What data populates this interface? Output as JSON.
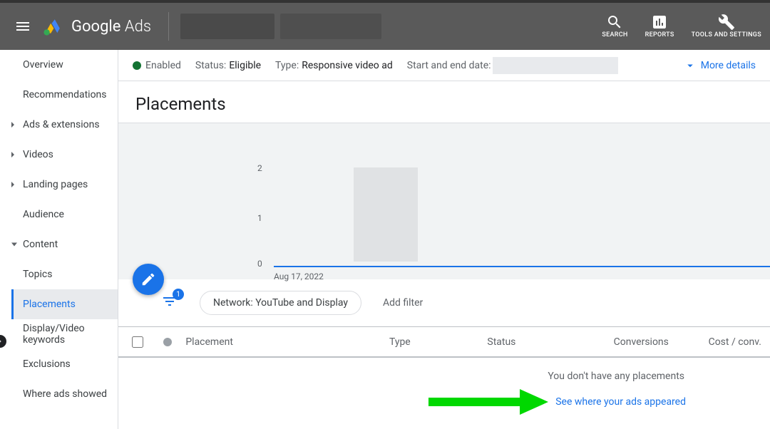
{
  "header": {
    "logo_text1": "Google",
    "logo_text2": "Ads",
    "actions": {
      "search": "SEARCH",
      "reports": "REPORTS",
      "tools": "TOOLS AND SETTINGS"
    }
  },
  "sidebar": {
    "items": [
      {
        "label": "Overview",
        "arrow": false
      },
      {
        "label": "Recommendations",
        "arrow": false
      },
      {
        "label": "Ads & extensions",
        "arrow": true
      },
      {
        "label": "Videos",
        "arrow": true
      },
      {
        "label": "Landing pages",
        "arrow": true
      },
      {
        "label": "Audience",
        "arrow": false
      },
      {
        "label": "Content",
        "arrow": true,
        "expanded": true
      }
    ],
    "content_sub": [
      {
        "label": "Topics"
      },
      {
        "label": "Placements",
        "active": true
      },
      {
        "label": "Display/Video keywords"
      },
      {
        "label": "Exclusions"
      },
      {
        "label": "Where ads showed"
      }
    ]
  },
  "status": {
    "enabled": "Enabled",
    "status_label": "Status:",
    "status_value": "Eligible",
    "type_label": "Type:",
    "type_value": "Responsive video ad",
    "dates_label": "Start and end date:",
    "more_details": "More details"
  },
  "page_title": "Placements",
  "chart_data": {
    "type": "bar",
    "categories": [
      "Aug 17, 2022"
    ],
    "values": [
      0
    ],
    "y_ticks": [
      0,
      1,
      2
    ],
    "x_start_label": "Aug 17, 2022",
    "ylim": [
      0,
      2
    ]
  },
  "filters": {
    "badge_count": "1",
    "chip": "Network: YouTube and Display",
    "add_filter": "Add filter"
  },
  "table": {
    "columns": {
      "placement": "Placement",
      "type": "Type",
      "status": "Status",
      "conversions": "Conversions",
      "cost_conv": "Cost / conv."
    }
  },
  "empty": {
    "message": "You don't have any placements",
    "link": "See where your ads appeared"
  }
}
